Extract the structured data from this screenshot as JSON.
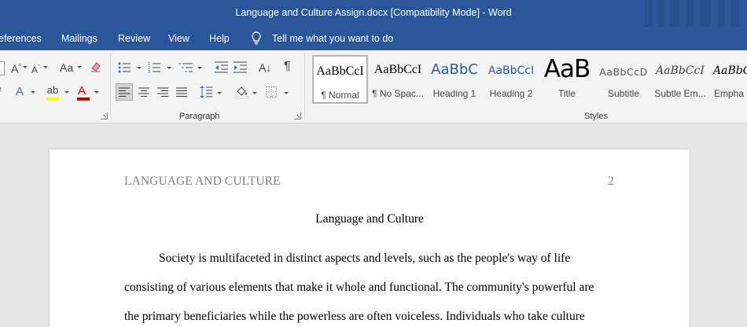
{
  "window": {
    "title": "Language and Culture Assign.docx [Compatibility Mode]  -  Word"
  },
  "menu": {
    "items": [
      "eferences",
      "Mailings",
      "Review",
      "View",
      "Help"
    ],
    "tell_me": "Tell me what you want to do"
  },
  "ribbon": {
    "paragraph_label": "Paragraph",
    "styles_label": "Styles",
    "styles": [
      {
        "sample": "AaBbCcI",
        "name": "¶ Normal"
      },
      {
        "sample": "AaBbCcI",
        "name": "¶ No Spac..."
      },
      {
        "sample": "AaBbC",
        "name": "Heading 1"
      },
      {
        "sample": "AaBbCcI",
        "name": "Heading 2"
      },
      {
        "sample": "AaB",
        "name": "Title"
      },
      {
        "sample": "AaBbCcD",
        "name": "Subtitle"
      },
      {
        "sample": "AaBbCcI",
        "name": "Subtle Em..."
      },
      {
        "sample": "AaBbCcI",
        "name": "Empha"
      }
    ],
    "colors": {
      "highlight": "#ffff00",
      "font_color": "#c00000",
      "accent": "#2b579a"
    }
  },
  "document": {
    "header": "LANGUAGE AND CULTURE",
    "page_number": "2",
    "title": "Language and Culture",
    "lines": [
      "Society is multifaceted in distinct aspects and levels, such as the people's way of life",
      "consisting of various elements that make it whole and functional. The community's powerful are",
      "the primary beneficiaries while the powerless are often voiceless. Individuals who take culture"
    ]
  }
}
